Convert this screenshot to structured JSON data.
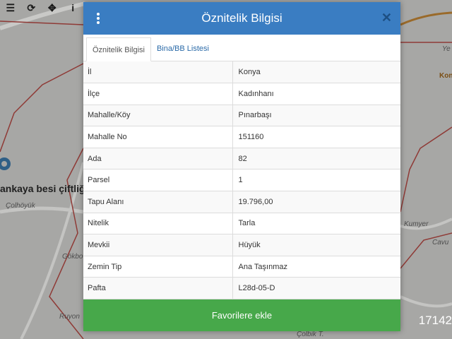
{
  "toolbar": {
    "items": [
      {
        "icon": "menu-icon",
        "glyph": "☰"
      },
      {
        "icon": "refresh-icon",
        "glyph": "⟳"
      },
      {
        "icon": "move-icon",
        "glyph": "✥"
      },
      {
        "icon": "info-icon",
        "glyph": "i"
      }
    ]
  },
  "map": {
    "labels": {
      "besi": "ankaya besi çiftliği",
      "colhoyuk": "Çolhöyük",
      "gokbo": "Gökbo",
      "ruyon": "Ruyon",
      "kumyer": "Kumyer",
      "cavus": "Cavu",
      "ye": "Ye",
      "kon": "Kon",
      "colbik": "Çolbik T."
    },
    "scale_readout": "17142"
  },
  "modal": {
    "title": "Öznitelik Bilgisi",
    "tabs": [
      {
        "label": "Öznitelik Bilgisi",
        "active": true
      },
      {
        "label": "Bina/BB Listesi",
        "active": false
      }
    ],
    "rows": [
      {
        "key": "İl",
        "value": "Konya"
      },
      {
        "key": "İlçe",
        "value": "Kadınhanı"
      },
      {
        "key": "Mahalle/Köy",
        "value": "Pınarbaşı"
      },
      {
        "key": "Mahalle No",
        "value": "151160"
      },
      {
        "key": "Ada",
        "value": "82"
      },
      {
        "key": "Parsel",
        "value": "1"
      },
      {
        "key": "Tapu Alanı",
        "value": "19.796,00"
      },
      {
        "key": "Nitelik",
        "value": "Tarla"
      },
      {
        "key": "Mevkii",
        "value": "Hüyük"
      },
      {
        "key": "Zemin Tip",
        "value": "Ana Taşınmaz"
      },
      {
        "key": "Pafta",
        "value": "L28d-05-D"
      }
    ],
    "favorite_button": "Favorilere ekle"
  },
  "colors": {
    "header": "#3a7dc2",
    "button": "#47a84a",
    "parcel_line": "#c0392b",
    "road": "#8a6a3a"
  }
}
